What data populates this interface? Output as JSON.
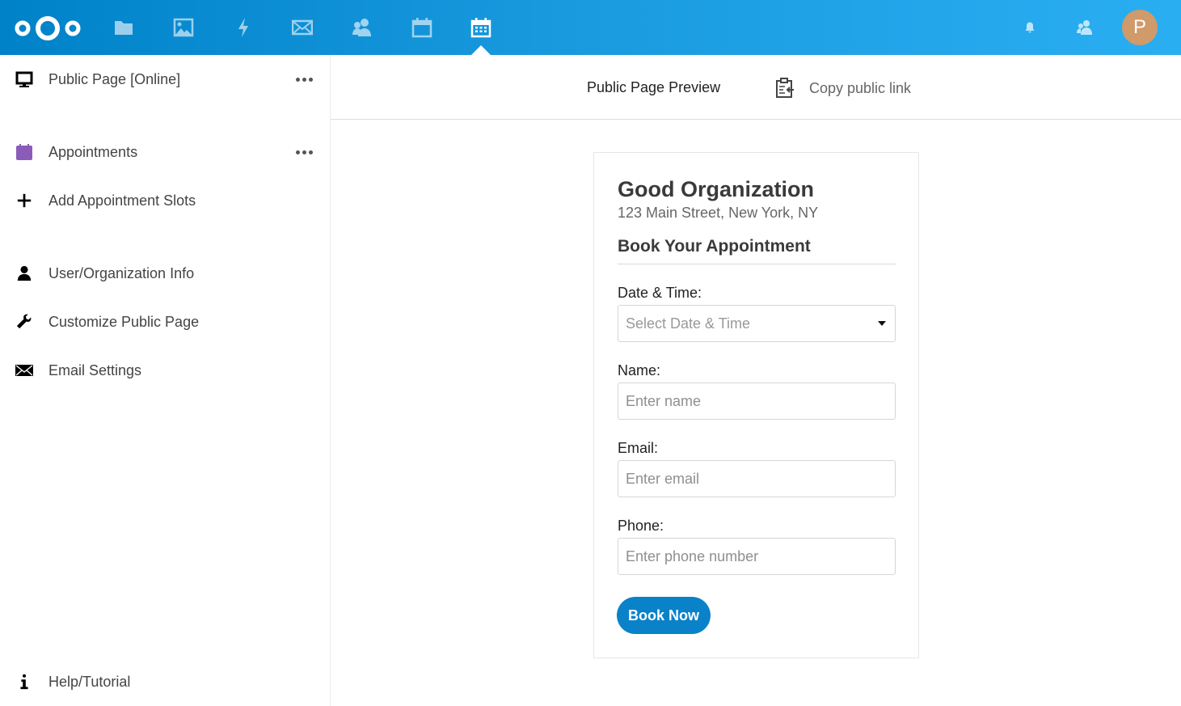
{
  "header": {
    "apps": [
      {
        "name": "files",
        "icon": "folder-icon"
      },
      {
        "name": "photos",
        "icon": "image-icon"
      },
      {
        "name": "activity",
        "icon": "lightning-icon"
      },
      {
        "name": "mail",
        "icon": "mail-icon"
      },
      {
        "name": "contacts",
        "icon": "contacts-icon"
      },
      {
        "name": "calendar",
        "icon": "calendar-icon"
      },
      {
        "name": "appointments",
        "icon": "calendar-grid-icon",
        "active": true
      }
    ],
    "avatar_initial": "P",
    "brand_color": "#0082c9"
  },
  "sidebar": {
    "items": [
      {
        "label": "Public Page [Online]",
        "icon": "monitor-icon",
        "has_menu": true
      },
      {
        "label": "Appointments",
        "icon": "calendar-icon",
        "has_menu": true
      },
      {
        "label": "Add Appointment Slots",
        "icon": "plus-icon"
      },
      {
        "label": "User/Organization Info",
        "icon": "user-icon"
      },
      {
        "label": "Customize Public Page",
        "icon": "wrench-icon"
      },
      {
        "label": "Email Settings",
        "icon": "mail-icon"
      },
      {
        "label": "Help/Tutorial",
        "icon": "info-icon"
      }
    ]
  },
  "topbar": {
    "preview_title": "Public Page Preview",
    "copy_link_label": "Copy public link"
  },
  "form": {
    "org_name": "Good Organization",
    "org_address": "123 Main Street, New York, NY",
    "title": "Book Your Appointment",
    "datetime_label": "Date & Time:",
    "datetime_placeholder": "Select Date & Time",
    "name_label": "Name:",
    "name_placeholder": "Enter name",
    "email_label": "Email:",
    "email_placeholder": "Enter email",
    "phone_label": "Phone:",
    "phone_placeholder": "Enter phone number",
    "submit_label": "Book Now",
    "submit_color": "#0a82c9"
  }
}
